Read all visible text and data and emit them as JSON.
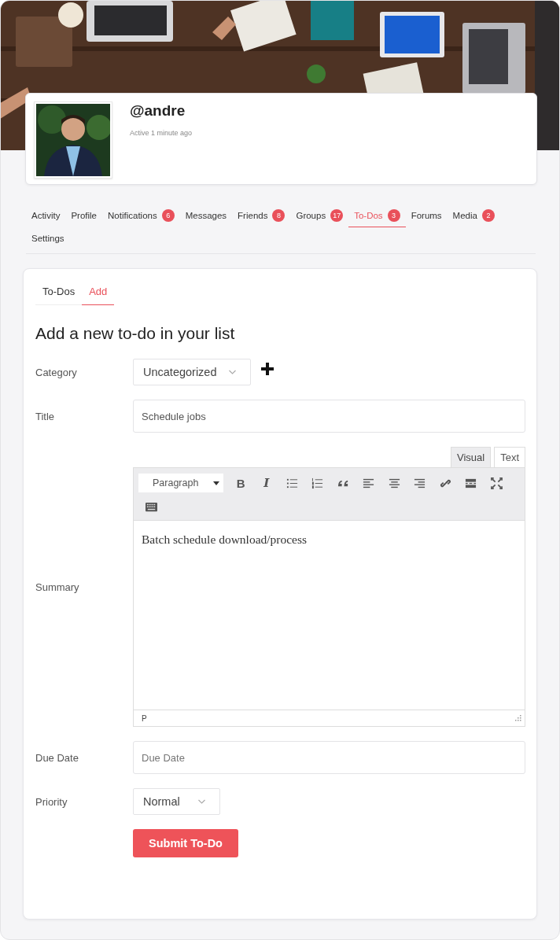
{
  "profile": {
    "username": "@andre",
    "activity": "Active 1 minute ago"
  },
  "nav": [
    {
      "label": "Activity",
      "selected": false
    },
    {
      "label": "Profile",
      "selected": false
    },
    {
      "label": "Notifications",
      "count": "6",
      "selected": false
    },
    {
      "label": "Messages",
      "selected": false
    },
    {
      "label": "Friends",
      "count": "8",
      "selected": false
    },
    {
      "label": "Groups",
      "count": "17",
      "selected": false
    },
    {
      "label": "To-Dos",
      "count": "3",
      "selected": true
    },
    {
      "label": "Forums",
      "selected": false
    },
    {
      "label": "Media",
      "count": "2",
      "selected": false
    },
    {
      "label": "Settings",
      "selected": false
    }
  ],
  "subnav": [
    {
      "label": "To-Dos",
      "selected": false
    },
    {
      "label": "Add",
      "selected": true
    }
  ],
  "form": {
    "heading": "Add a new to-do in your list",
    "category": {
      "label": "Category",
      "value": "Uncategorized"
    },
    "title": {
      "label": "Title",
      "value": "Schedule jobs"
    },
    "summary": {
      "label": "Summary",
      "editor_tabs": [
        {
          "label": "Visual",
          "selected": true
        },
        {
          "label": "Text",
          "selected": false
        }
      ],
      "format": "Paragraph",
      "toolbar": [
        {
          "kind": "bold",
          "glyph": "B"
        },
        {
          "kind": "italic",
          "glyph": "I"
        },
        {
          "kind": "bullets"
        },
        {
          "kind": "numbers"
        },
        {
          "kind": "quote"
        },
        {
          "kind": "left"
        },
        {
          "kind": "center"
        },
        {
          "kind": "right"
        },
        {
          "kind": "link"
        },
        {
          "kind": "more"
        },
        {
          "kind": "fullscreen"
        },
        {
          "kind": "keyboard"
        }
      ],
      "content": "Batch schedule download/process",
      "path": "P"
    },
    "due_date": {
      "label": "Due Date",
      "placeholder": "Due Date"
    },
    "priority": {
      "label": "Priority",
      "value": "Normal"
    },
    "submit": "Submit To-Do"
  }
}
